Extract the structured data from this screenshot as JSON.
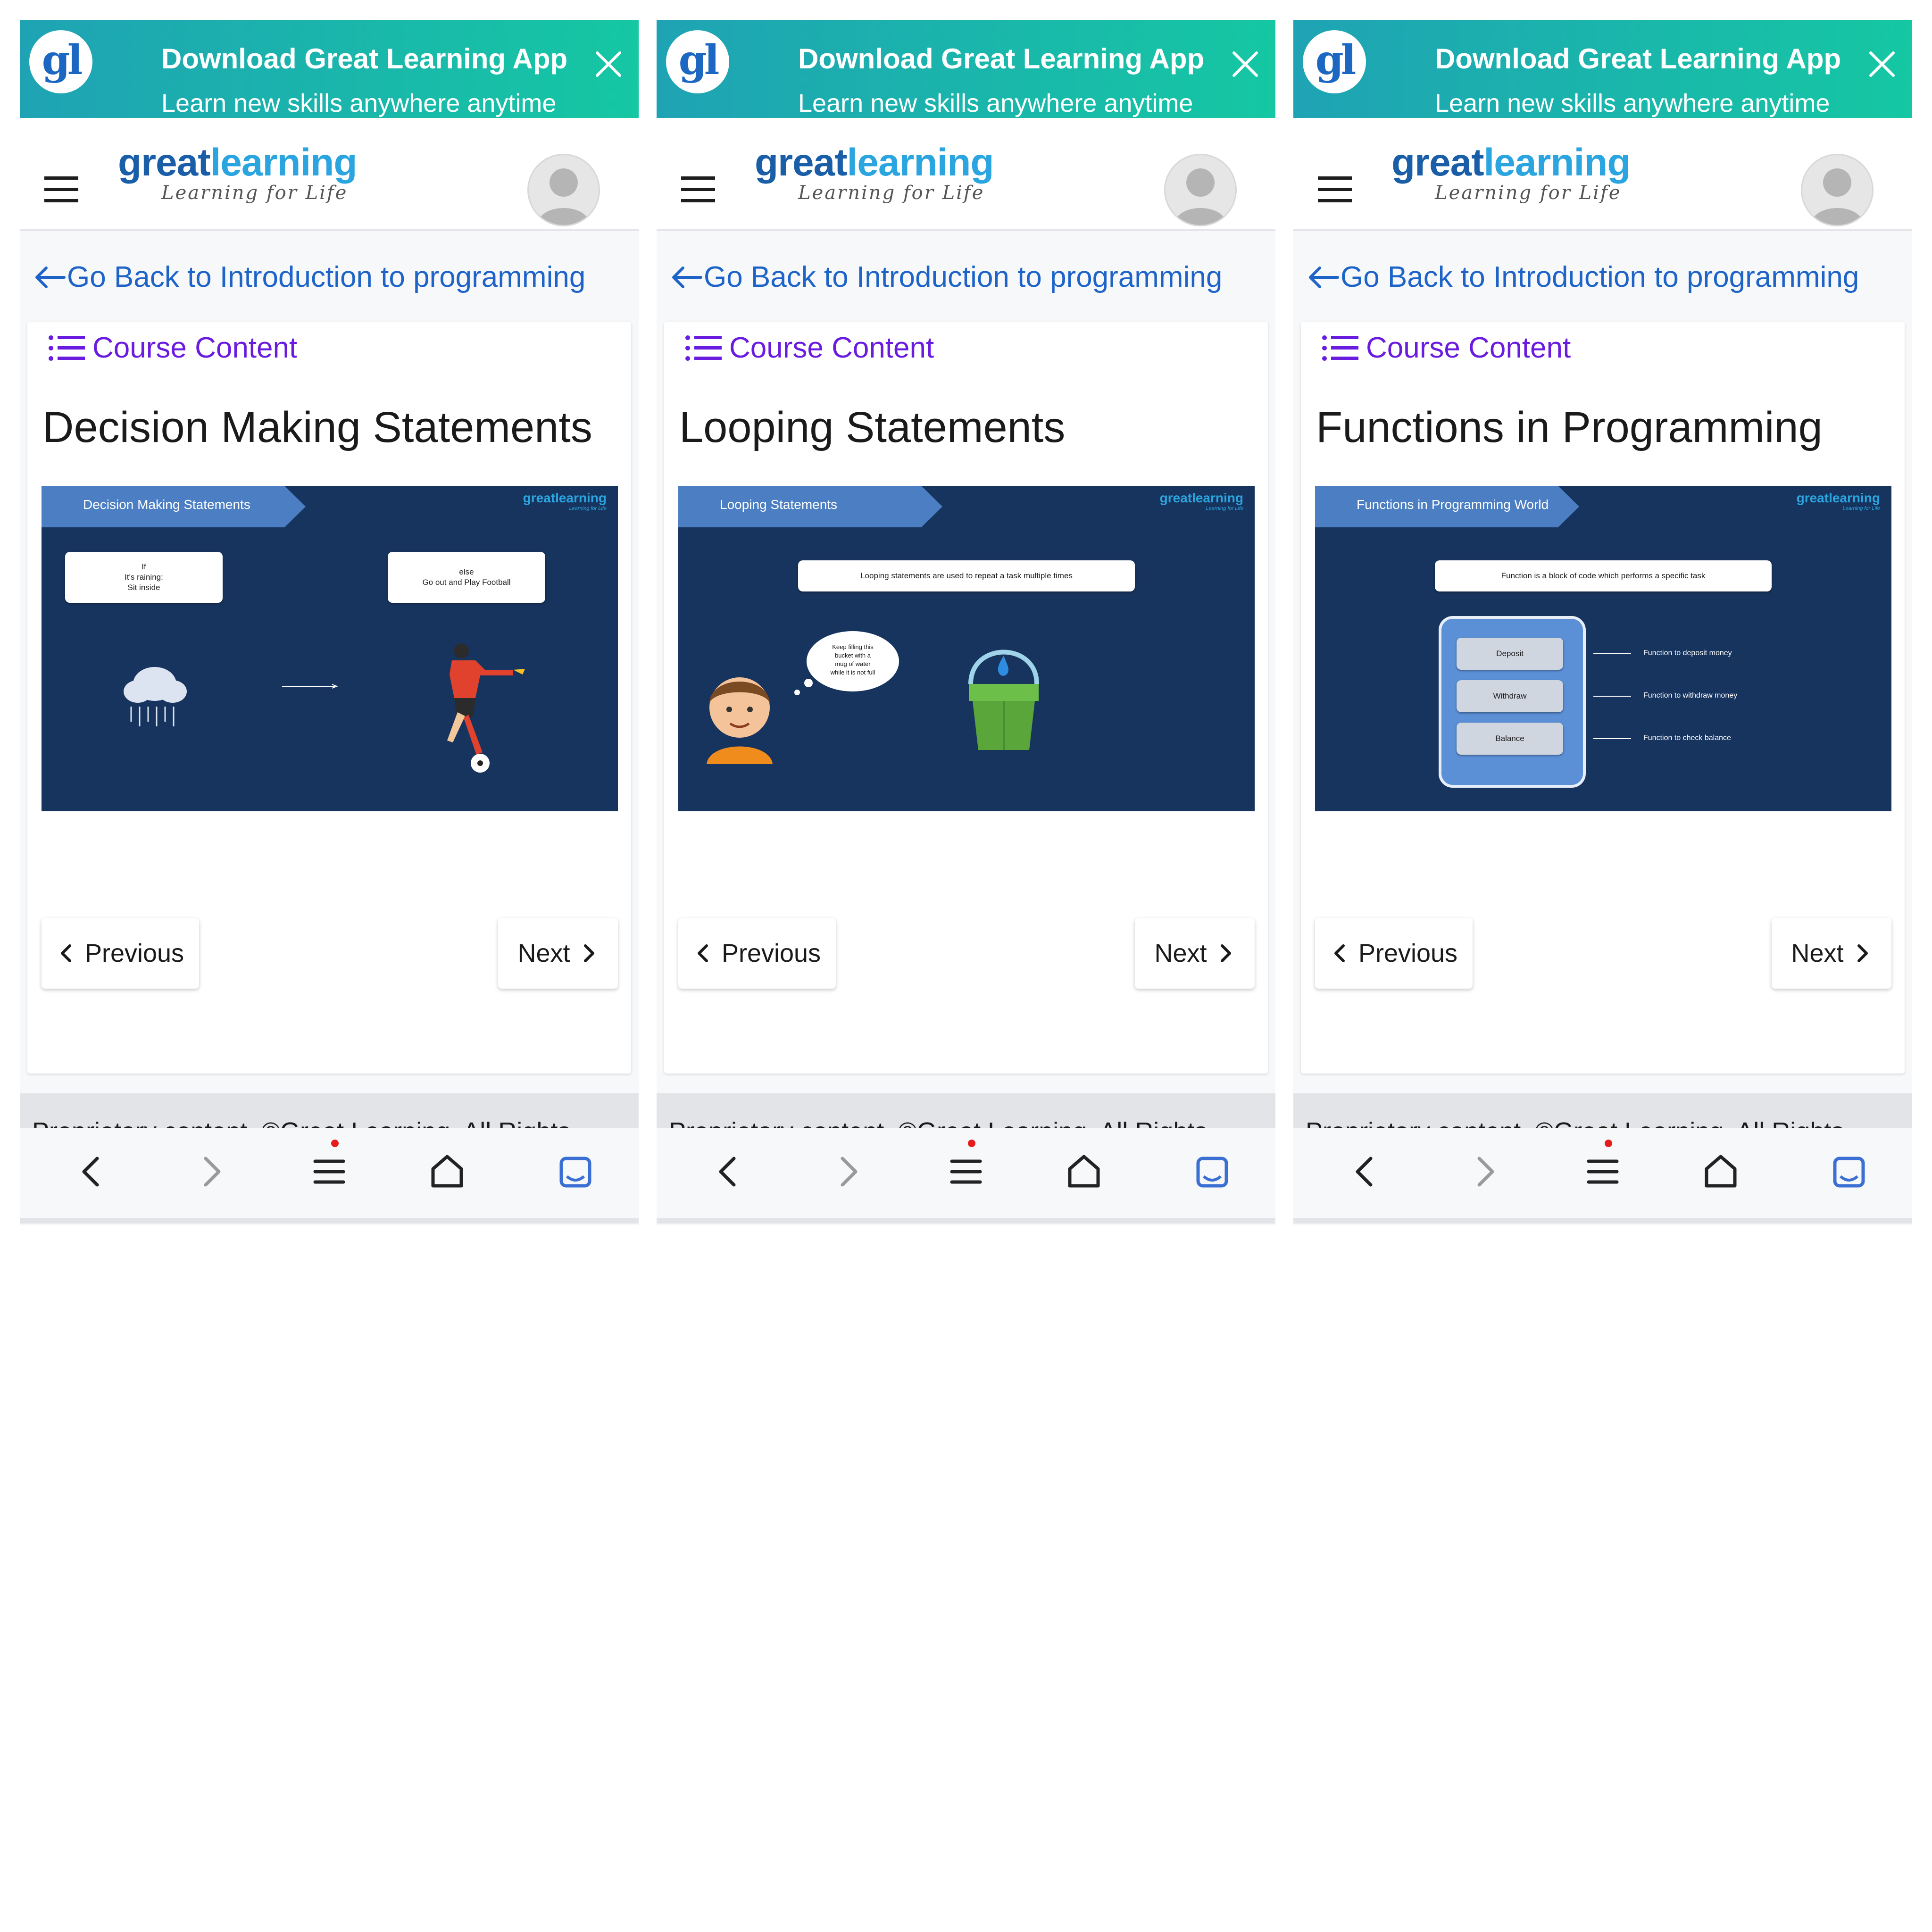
{
  "banner": {
    "logo": "gl",
    "title": "Download Great Learning App",
    "subtitle": "Learn new skills anywhere anytime"
  },
  "header": {
    "logo_great": "great",
    "logo_learning": "learning",
    "tagline": "Learning for Life"
  },
  "back_link": "Go Back to Introduction to programming",
  "course_content_label": "Course Content",
  "nav": {
    "previous": "Previous",
    "next": "Next"
  },
  "footer_text": "Proprietary content. ©Great Learning. All Rights",
  "slide_brand": {
    "word": "greatlearning",
    "tagline": "Learning for Life"
  },
  "screens": [
    {
      "lesson_title": "Decision Making Statements",
      "slide": {
        "tab": "Decision Making Statements",
        "if_box": [
          "If",
          "It's raining:",
          "Sit inside"
        ],
        "else_box": [
          "else",
          "Go out and Play Football"
        ]
      }
    },
    {
      "lesson_title": "Looping Statements",
      "slide": {
        "tab": "Looping Statements",
        "caption": "Looping statements are used to repeat a task multiple times",
        "thought": [
          "Keep filling this",
          "bucket with a",
          "mug of water",
          "while it is not full"
        ]
      }
    },
    {
      "lesson_title": "Functions in Programming",
      "slide": {
        "tab": "Functions in Programming World",
        "caption": "Function is a block of code which performs a specific task",
        "buttons": [
          "Deposit",
          "Withdraw",
          "Balance"
        ],
        "descriptions": [
          "Function to deposit money",
          "Function to withdraw money",
          "Function to check balance"
        ]
      }
    }
  ],
  "colors": {
    "banner_start": "#1fa3b4",
    "banner_end": "#15c7a3",
    "link_blue": "#1e64c8",
    "course_content_purple": "#6a1be0",
    "slide_bg": "#17345f",
    "slide_tab": "#4b7ec2",
    "notification_dot": "#e61b1b"
  },
  "icons": [
    "close-icon",
    "hamburger-icon",
    "avatar-icon",
    "arrow-left-icon",
    "list-icon",
    "chevron-left-icon",
    "chevron-right-icon",
    "browser-back-icon",
    "browser-forward-icon",
    "browser-menu-icon",
    "home-icon",
    "tabs-icon"
  ]
}
